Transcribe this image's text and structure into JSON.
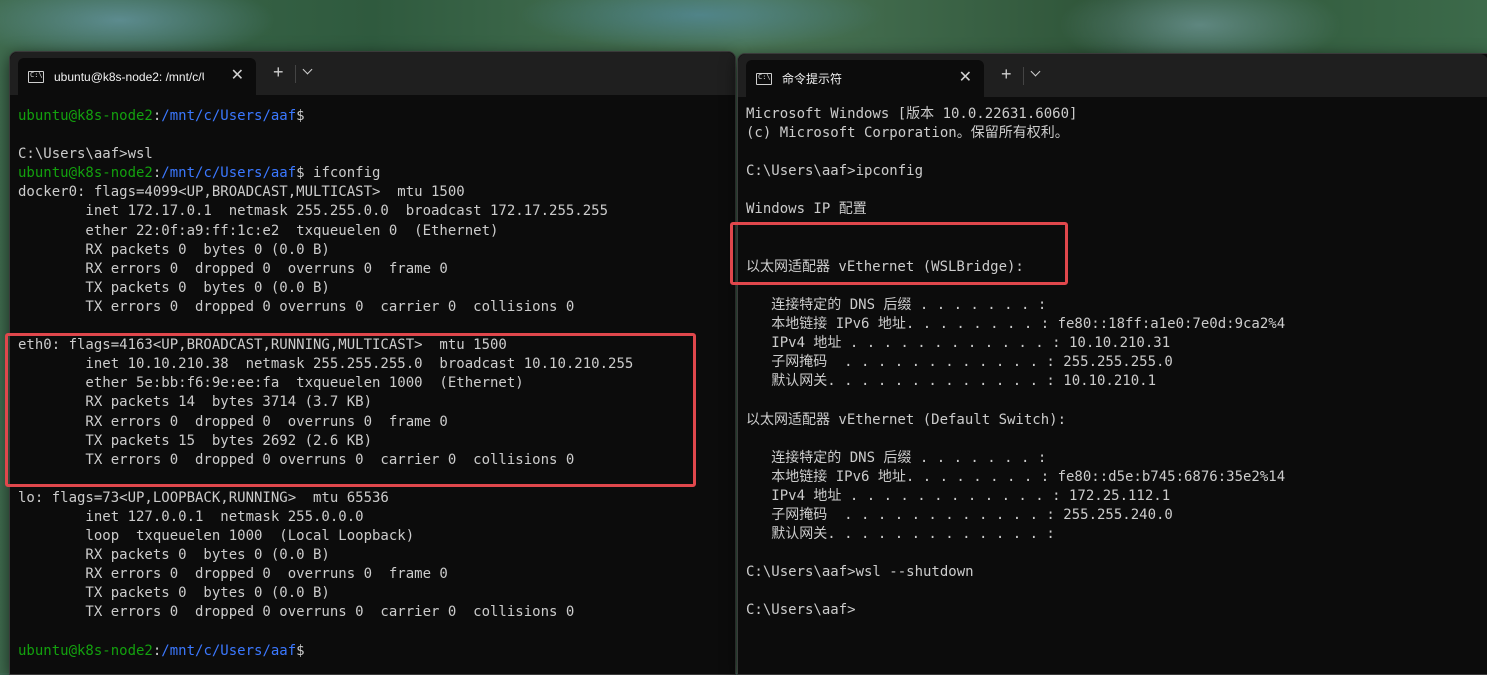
{
  "left_window": {
    "tab_title": "ubuntu@k8s-node2: /mnt/c/U",
    "new_tab": "+",
    "lines": [
      {
        "segments": [
          {
            "t": "ubuntu@k8s-node2",
            "c": "g"
          },
          {
            "t": ":",
            "c": "w"
          },
          {
            "t": "/mnt/c/Users/aaf",
            "c": "b"
          },
          {
            "t": "$",
            "c": "w"
          }
        ]
      },
      {
        "segments": [
          {
            "t": "",
            "c": "w"
          }
        ]
      },
      {
        "segments": [
          {
            "t": "C:\\Users\\aaf>wsl",
            "c": "w"
          }
        ]
      },
      {
        "segments": [
          {
            "t": "ubuntu@k8s-node2",
            "c": "g"
          },
          {
            "t": ":",
            "c": "w"
          },
          {
            "t": "/mnt/c/Users/aaf",
            "c": "b"
          },
          {
            "t": "$ ifconfig",
            "c": "w"
          }
        ]
      },
      {
        "segments": [
          {
            "t": "docker0: flags=4099<UP,BROADCAST,MULTICAST>  mtu 1500",
            "c": "w"
          }
        ]
      },
      {
        "segments": [
          {
            "t": "        inet 172.17.0.1  netmask 255.255.0.0  broadcast 172.17.255.255",
            "c": "w"
          }
        ]
      },
      {
        "segments": [
          {
            "t": "        ether 22:0f:a9:ff:1c:e2  txqueuelen 0  (Ethernet)",
            "c": "w"
          }
        ]
      },
      {
        "segments": [
          {
            "t": "        RX packets 0  bytes 0 (0.0 B)",
            "c": "w"
          }
        ]
      },
      {
        "segments": [
          {
            "t": "        RX errors 0  dropped 0  overruns 0  frame 0",
            "c": "w"
          }
        ]
      },
      {
        "segments": [
          {
            "t": "        TX packets 0  bytes 0 (0.0 B)",
            "c": "w"
          }
        ]
      },
      {
        "segments": [
          {
            "t": "        TX errors 0  dropped 0 overruns 0  carrier 0  collisions 0",
            "c": "w"
          }
        ]
      },
      {
        "segments": [
          {
            "t": "",
            "c": "w"
          }
        ]
      },
      {
        "segments": [
          {
            "t": "eth0: flags=4163<UP,BROADCAST,RUNNING,MULTICAST>  mtu 1500",
            "c": "w"
          }
        ]
      },
      {
        "segments": [
          {
            "t": "        inet 10.10.210.38  netmask 255.255.255.0  broadcast 10.10.210.255",
            "c": "w"
          }
        ]
      },
      {
        "segments": [
          {
            "t": "        ether 5e:bb:f6:9e:ee:fa  txqueuelen 1000  (Ethernet)",
            "c": "w"
          }
        ]
      },
      {
        "segments": [
          {
            "t": "        RX packets 14  bytes 3714 (3.7 KB)",
            "c": "w"
          }
        ]
      },
      {
        "segments": [
          {
            "t": "        RX errors 0  dropped 0  overruns 0  frame 0",
            "c": "w"
          }
        ]
      },
      {
        "segments": [
          {
            "t": "        TX packets 15  bytes 2692 (2.6 KB)",
            "c": "w"
          }
        ]
      },
      {
        "segments": [
          {
            "t": "        TX errors 0  dropped 0 overruns 0  carrier 0  collisions 0",
            "c": "w"
          }
        ]
      },
      {
        "segments": [
          {
            "t": "",
            "c": "w"
          }
        ]
      },
      {
        "segments": [
          {
            "t": "lo: flags=73<UP,LOOPBACK,RUNNING>  mtu 65536",
            "c": "w"
          }
        ]
      },
      {
        "segments": [
          {
            "t": "        inet 127.0.0.1  netmask 255.0.0.0",
            "c": "w"
          }
        ]
      },
      {
        "segments": [
          {
            "t": "        loop  txqueuelen 1000  (Local Loopback)",
            "c": "w"
          }
        ]
      },
      {
        "segments": [
          {
            "t": "        RX packets 0  bytes 0 (0.0 B)",
            "c": "w"
          }
        ]
      },
      {
        "segments": [
          {
            "t": "        RX errors 0  dropped 0  overruns 0  frame 0",
            "c": "w"
          }
        ]
      },
      {
        "segments": [
          {
            "t": "        TX packets 0  bytes 0 (0.0 B)",
            "c": "w"
          }
        ]
      },
      {
        "segments": [
          {
            "t": "        TX errors 0  dropped 0 overruns 0  carrier 0  collisions 0",
            "c": "w"
          }
        ]
      },
      {
        "segments": [
          {
            "t": "",
            "c": "w"
          }
        ]
      },
      {
        "segments": [
          {
            "t": "ubuntu@k8s-node2",
            "c": "g"
          },
          {
            "t": ":",
            "c": "w"
          },
          {
            "t": "/mnt/c/Users/aaf",
            "c": "b"
          },
          {
            "t": "$",
            "c": "w"
          }
        ]
      }
    ]
  },
  "right_window": {
    "tab_title": "命令提示符",
    "new_tab": "+",
    "lines": [
      {
        "segments": [
          {
            "t": "Microsoft Windows [版本 10.0.22631.6060]",
            "c": "w"
          }
        ]
      },
      {
        "segments": [
          {
            "t": "(c) Microsoft Corporation。保留所有权利。",
            "c": "w"
          }
        ]
      },
      {
        "segments": [
          {
            "t": "",
            "c": "w"
          }
        ]
      },
      {
        "segments": [
          {
            "t": "C:\\Users\\aaf>ipconfig",
            "c": "w"
          }
        ]
      },
      {
        "segments": [
          {
            "t": "",
            "c": "w"
          }
        ]
      },
      {
        "segments": [
          {
            "t": "Windows IP 配置",
            "c": "w"
          }
        ]
      },
      {
        "segments": [
          {
            "t": "",
            "c": "w"
          }
        ]
      },
      {
        "segments": [
          {
            "t": "",
            "c": "w"
          }
        ]
      },
      {
        "segments": [
          {
            "t": "以太网适配器 vEthernet (WSLBridge):",
            "c": "w"
          }
        ]
      },
      {
        "segments": [
          {
            "t": "",
            "c": "w"
          }
        ]
      },
      {
        "segments": [
          {
            "t": "   连接特定的 DNS 后缀 . . . . . . . :",
            "c": "w"
          }
        ]
      },
      {
        "segments": [
          {
            "t": "   本地链接 IPv6 地址. . . . . . . . : fe80::18ff:a1e0:7e0d:9ca2%4",
            "c": "w"
          }
        ]
      },
      {
        "segments": [
          {
            "t": "   IPv4 地址 . . . . . . . . . . . . : 10.10.210.31",
            "c": "w"
          }
        ]
      },
      {
        "segments": [
          {
            "t": "   子网掩码  . . . . . . . . . . . . : 255.255.255.0",
            "c": "w"
          }
        ]
      },
      {
        "segments": [
          {
            "t": "   默认网关. . . . . . . . . . . . . : 10.10.210.1",
            "c": "w"
          }
        ]
      },
      {
        "segments": [
          {
            "t": "",
            "c": "w"
          }
        ]
      },
      {
        "segments": [
          {
            "t": "以太网适配器 vEthernet (Default Switch):",
            "c": "w"
          }
        ]
      },
      {
        "segments": [
          {
            "t": "",
            "c": "w"
          }
        ]
      },
      {
        "segments": [
          {
            "t": "   连接特定的 DNS 后缀 . . . . . . . :",
            "c": "w"
          }
        ]
      },
      {
        "segments": [
          {
            "t": "   本地链接 IPv6 地址. . . . . . . . : fe80::d5e:b745:6876:35e2%14",
            "c": "w"
          }
        ]
      },
      {
        "segments": [
          {
            "t": "   IPv4 地址 . . . . . . . . . . . . : 172.25.112.1",
            "c": "w"
          }
        ]
      },
      {
        "segments": [
          {
            "t": "   子网掩码  . . . . . . . . . . . . : 255.255.240.0",
            "c": "w"
          }
        ]
      },
      {
        "segments": [
          {
            "t": "   默认网关. . . . . . . . . . . . . :",
            "c": "w"
          }
        ]
      },
      {
        "segments": [
          {
            "t": "",
            "c": "w"
          }
        ]
      },
      {
        "segments": [
          {
            "t": "C:\\Users\\aaf>wsl --shutdown",
            "c": "w"
          }
        ]
      },
      {
        "segments": [
          {
            "t": "",
            "c": "w"
          }
        ]
      },
      {
        "segments": [
          {
            "t": "C:\\Users\\aaf>",
            "c": "w"
          }
        ]
      }
    ]
  },
  "colors": {
    "prompt_user": "#13a10e",
    "prompt_path": "#3b78ff",
    "text": "#cccccc",
    "highlight_box": "#e0474c",
    "terminal_bg": "#0c0c0c"
  },
  "icons": {
    "tab_icon": "terminal-icon",
    "close": "close-icon",
    "new_tab": "plus-icon",
    "dropdown": "chevron-down-icon"
  }
}
